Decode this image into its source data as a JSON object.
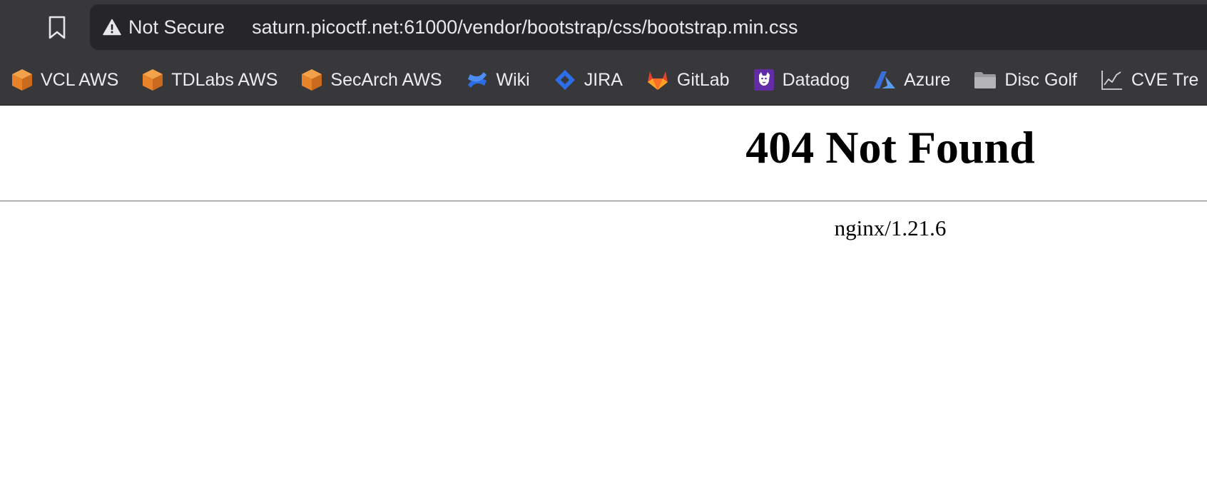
{
  "browser": {
    "bookmark_button_icon": "bookmark-outline-icon",
    "address_bar": {
      "security_icon": "warning-triangle-icon",
      "security_label": "Not Secure",
      "url": "saturn.picoctf.net:61000/vendor/bootstrap/css/bootstrap.min.css"
    },
    "bookmarks": [
      {
        "label": "VCL AWS",
        "icon": "aws-cube-icon"
      },
      {
        "label": "TDLabs AWS",
        "icon": "aws-cube-icon"
      },
      {
        "label": "SecArch AWS",
        "icon": "aws-cube-icon"
      },
      {
        "label": "Wiki",
        "icon": "confluence-icon"
      },
      {
        "label": "JIRA",
        "icon": "jira-icon"
      },
      {
        "label": "GitLab",
        "icon": "gitlab-fox-icon"
      },
      {
        "label": "Datadog",
        "icon": "datadog-dog-icon"
      },
      {
        "label": "Azure",
        "icon": "azure-icon"
      },
      {
        "label": "Disc Golf",
        "icon": "folder-icon"
      },
      {
        "label": "CVE Tre",
        "icon": "line-chart-icon"
      }
    ]
  },
  "page": {
    "heading": "404 Not Found",
    "server_signature": "nginx/1.21.6"
  },
  "colors": {
    "toolbar_bg": "#38383b",
    "url_bar_bg": "#26262a",
    "aws_orange": "#e8832a",
    "confluence_blue": "#2d6ee6",
    "jira_blue": "#2d6ee6",
    "gitlab_orange": "#e2432a",
    "datadog_purple": "#632ca6",
    "azure_blue": "#3a6fd8",
    "folder_gray": "#9a9a9e"
  }
}
